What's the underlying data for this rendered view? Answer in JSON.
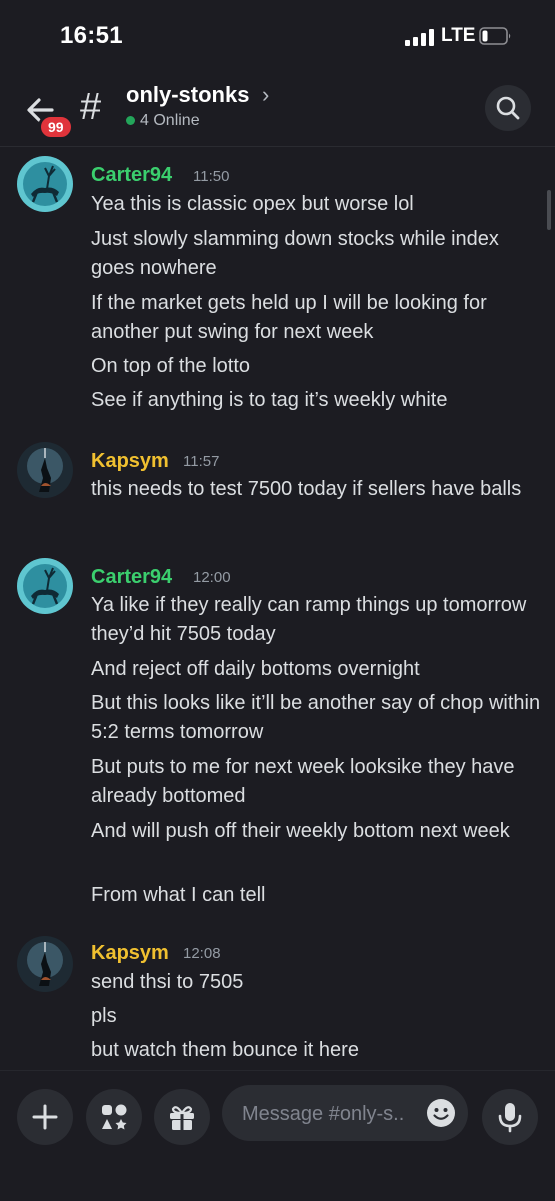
{
  "status": {
    "time": "16:51",
    "network": "LTE"
  },
  "header": {
    "channel": "only-stonks",
    "unread_badge": "99",
    "online": "4 Online",
    "online_color": "#23a55a"
  },
  "messages": [
    {
      "author": "Carter94",
      "author_color": "#3bcf6e",
      "time": "11:50",
      "lines": [
        "Yea this is classic opex but worse lol",
        "Just slowly slamming down stocks while index goes nowhere",
        "If the market gets held up I will be looking for another put swing for next week",
        "On top of the lotto",
        "See if anything is to tag it’s weekly white"
      ]
    },
    {
      "author": "Kapsym",
      "author_color": "#f0c030",
      "time": "11:57",
      "lines": [
        "this needs to test 7500 today if sellers have balls"
      ]
    },
    {
      "author": "Carter94",
      "author_color": "#3bcf6e",
      "time": "12:00",
      "lines": [
        "Ya like if they really can ramp things up tomorrow they’d hit 7505 today",
        "And reject off daily bottoms overnight",
        "But this looks like it’ll be another say of chop within 5:2 terms tomorrow",
        "But puts to me for next week looksike they have already bottomed",
        "And will push off their weekly bottom next week",
        "From what I can tell"
      ]
    },
    {
      "author": "Kapsym",
      "author_color": "#f0c030",
      "time": "12:08",
      "lines": [
        "send thsi to 7505",
        "pls",
        "but watch them bounce it here"
      ]
    }
  ],
  "composer": {
    "placeholder": "Message #only-s..",
    "icons": [
      "plus-icon",
      "apps-icon",
      "gift-icon",
      "emoji-icon",
      "microphone-icon"
    ]
  }
}
